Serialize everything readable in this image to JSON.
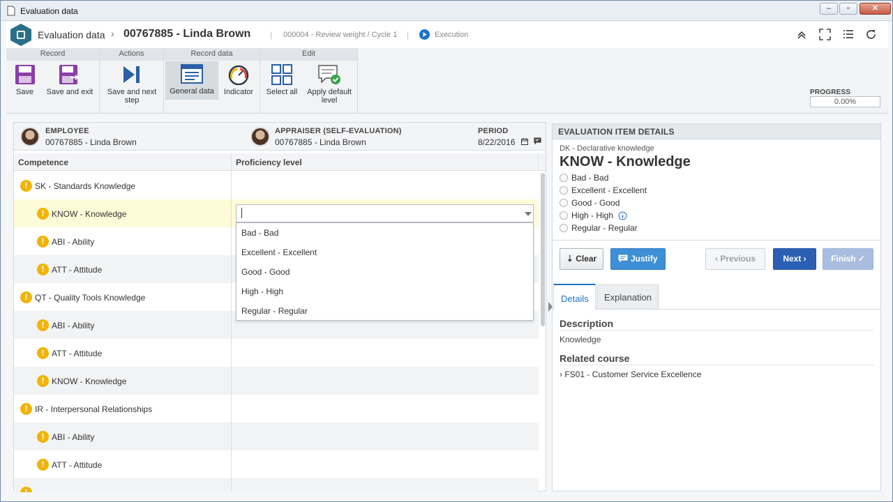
{
  "window": {
    "title": "Evaluation data",
    "controls": {
      "minimize": "–",
      "maximize": "▫",
      "close": "✕"
    }
  },
  "header": {
    "module": "Evaluation data",
    "record": "00767885 - Linda Brown",
    "cycle": "000004 - Review weight / Cycle 1",
    "status": "Execution"
  },
  "ribbon": {
    "groups": {
      "record": "Record",
      "actions": "Actions",
      "record_data": "Record data",
      "edit": "Edit"
    },
    "buttons": {
      "save": "Save",
      "save_exit": "Save and exit",
      "save_next": "Save and next step",
      "general_data": "General data",
      "indicator": "Indicator",
      "select_all": "Select all",
      "apply_default": "Apply default level"
    },
    "progress": {
      "label": "PROGRESS",
      "value": "0.00%"
    }
  },
  "info": {
    "employee": {
      "caption": "EMPLOYEE",
      "value": "00767885 - Linda Brown"
    },
    "appraiser": {
      "caption": "APPRAISER (SELF-EVALUATION)",
      "value": "00767885 - Linda Brown"
    },
    "period": {
      "caption": "PERIOD",
      "value": "8/22/2016"
    }
  },
  "table": {
    "columns": [
      "Competence",
      "Proficiency level"
    ],
    "rows": [
      {
        "label": "SK - Standards Knowledge"
      },
      {
        "label": "KNOW - Knowledge"
      },
      {
        "label": "ABI - Ability"
      },
      {
        "label": "ATT - Attitude"
      },
      {
        "label": "QT - Quality Tools Knowledge"
      },
      {
        "label": "ABI - Ability"
      },
      {
        "label": "ATT - Attitude"
      },
      {
        "label": "KNOW - Knowledge"
      },
      {
        "label": "IR - Interpersonal Relationships"
      },
      {
        "label": "ABI - Ability"
      },
      {
        "label": "ATT - Attitude"
      }
    ]
  },
  "dropdown": {
    "value": "",
    "options": [
      "Bad - Bad",
      "Excellent - Excellent",
      "Good - Good",
      "High - High",
      "Regular - Regular"
    ]
  },
  "details": {
    "header": "EVALUATION ITEM DETAILS",
    "category": "DK - Declarative knowledge",
    "title": "KNOW - Knowledge",
    "levels": [
      "Bad - Bad",
      "Excellent - Excellent",
      "Good - Good",
      "High - High",
      "Regular - Regular"
    ],
    "buttons": {
      "clear": "Clear",
      "justify": "Justify",
      "previous": "Previous",
      "next": "Next",
      "finish": "Finish"
    },
    "tabs": [
      "Details",
      "Explanation"
    ],
    "description_title": "Description",
    "description": "Knowledge",
    "related_title": "Related course",
    "related": "› FS01 - Customer Service Excellence"
  },
  "colors": {
    "accent": "#1a73c8",
    "next_button": "#2b5fb3",
    "justify_button": "#3d8fd6",
    "warning": "#f2b400",
    "selected_row": "#fdfbd8"
  }
}
